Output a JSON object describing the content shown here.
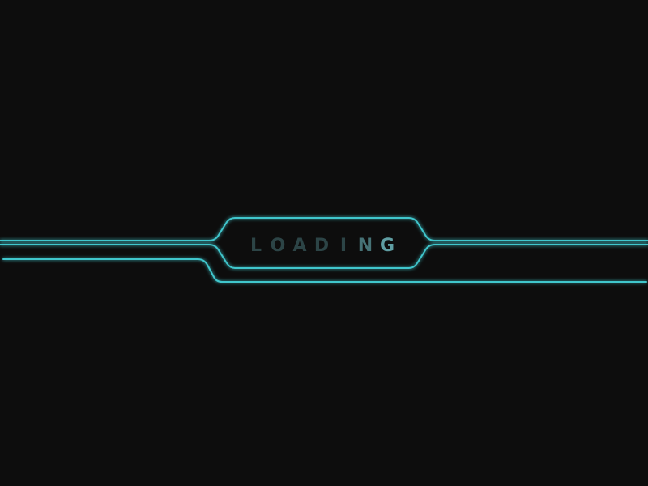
{
  "loader": {
    "title": "LOADING",
    "letters": [
      "L",
      "O",
      "A",
      "D",
      "I",
      "N",
      "G"
    ],
    "letter_opacity": [
      0.38,
      0.38,
      0.38,
      0.38,
      0.38,
      0.7,
      1.0
    ],
    "colors": {
      "background": "#0d0d0d",
      "line": "#3fc6cc",
      "glow": "#1e8f96",
      "text": "#5f9ea3"
    }
  }
}
